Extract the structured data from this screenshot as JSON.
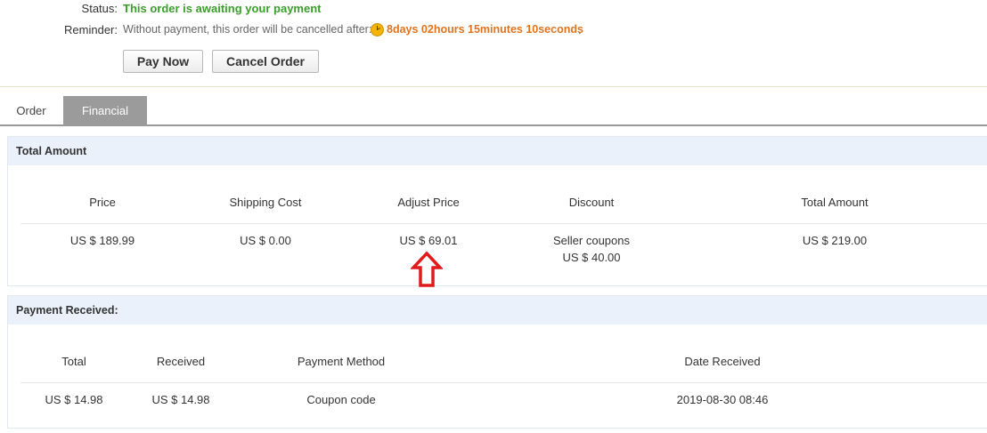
{
  "status": {
    "label": "Status:",
    "value": "This order is awaiting your payment"
  },
  "reminder": {
    "label": "Reminder:",
    "text": "Without payment, this order will be cancelled after:",
    "icon": "clock-icon",
    "countdown": "8days 02hours 15minutes 10seconds",
    "suffix": "."
  },
  "actions": {
    "pay_now": "Pay Now",
    "cancel_order": "Cancel Order"
  },
  "tabs": [
    {
      "label": "Order",
      "active": false
    },
    {
      "label": "Financial",
      "active": true
    }
  ],
  "total_amount": {
    "title": "Total Amount",
    "headers": [
      "Price",
      "Shipping Cost",
      "Adjust Price",
      "Discount",
      "Total Amount"
    ],
    "values": {
      "price": "US $ 189.99",
      "shipping": "US $ 0.00",
      "adjust": "US $ 69.01",
      "discount_label": "Seller coupons",
      "discount_value": "US $ 40.00",
      "total": "US $ 219.00"
    }
  },
  "payment_received": {
    "title": "Payment Received:",
    "headers": [
      "Total",
      "Received",
      "Payment Method",
      "Date Received"
    ],
    "row": [
      "US $ 14.98",
      "US $ 14.98",
      "Coupon code",
      "2019-08-30 08:46"
    ]
  },
  "colors": {
    "status_green": "#3a9e2b",
    "countdown_orange": "#e0741e",
    "panel_header_bg": "#eaf1fb",
    "annotation_red": "#e01b1b"
  }
}
